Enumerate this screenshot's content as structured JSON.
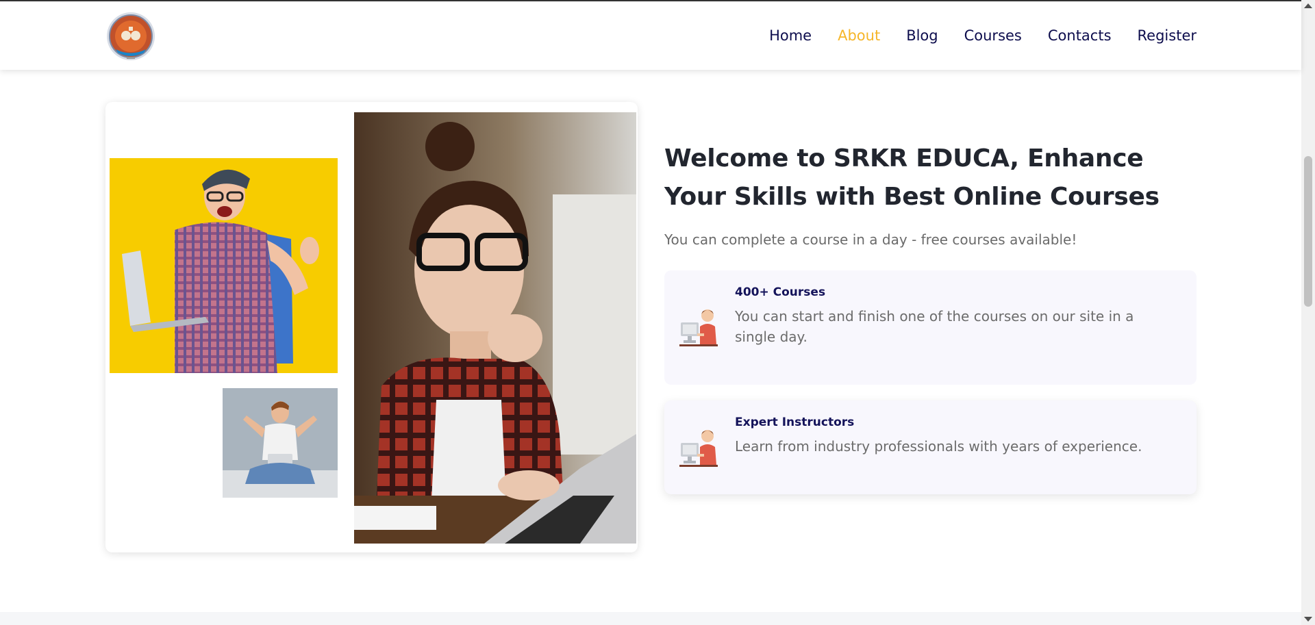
{
  "nav": {
    "items": [
      {
        "label": "Home",
        "active": false
      },
      {
        "label": "About",
        "active": true
      },
      {
        "label": "Blog",
        "active": false
      },
      {
        "label": "Courses",
        "active": false
      },
      {
        "label": "Contacts",
        "active": false
      },
      {
        "label": "Register",
        "active": false
      }
    ]
  },
  "logo": {
    "icon": "college-seal-logo"
  },
  "about": {
    "headline": "Welcome to SRKR EDUCA, Enhance Your Skills with Best Online Courses",
    "subtext": "You can complete a course in a day - free courses available!",
    "features": [
      {
        "title": "400+ Courses",
        "description": "You can start and finish one of the courses on our site in a single day.",
        "icon": "student-at-computer-icon"
      },
      {
        "title": "Expert Instructors",
        "description": "Learn from industry professionals with years of experience.",
        "icon": "student-at-computer-icon"
      }
    ]
  },
  "images": {
    "man_with_laptop": "student-with-laptop-photo",
    "excited_man": "excited-man-photo",
    "woman_at_laptop": "woman-working-on-laptop-photo"
  },
  "colors": {
    "nav_text": "#0d0d4d",
    "nav_active": "#f6b629",
    "headline": "#22262f",
    "feature_title": "#14135a",
    "feature_bg": "#f8f7fd"
  }
}
